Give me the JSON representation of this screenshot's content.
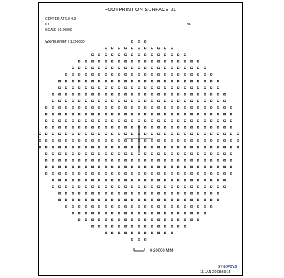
{
  "header": {
    "title": "FOOTPRINT ON SURFACE   21",
    "center": "CENTER AT 0.0 0.0",
    "id_label": "ID",
    "id_value": "96",
    "scale": "SCALE 50.00000",
    "wavelength": "WAVELENGTH  1.200000"
  },
  "footer": {
    "scale_bar_label": "0.20000 MM",
    "brand": "SYNOPSYS",
    "timestamp": "11-JAN-20 08:59:15"
  },
  "colors": {
    "ink": "#000000",
    "brand": "#1a4fd6"
  },
  "chart_data": {
    "type": "scatter",
    "title": "FOOTPRINT ON SURFACE   21",
    "description": "ray footprint points arranged on a uniform grid inside a circular aperture",
    "grid_points_across": 31,
    "marker": "hollow-square",
    "center": [
      0.0,
      0.0
    ],
    "scale_bar_mm": 0.2
  }
}
